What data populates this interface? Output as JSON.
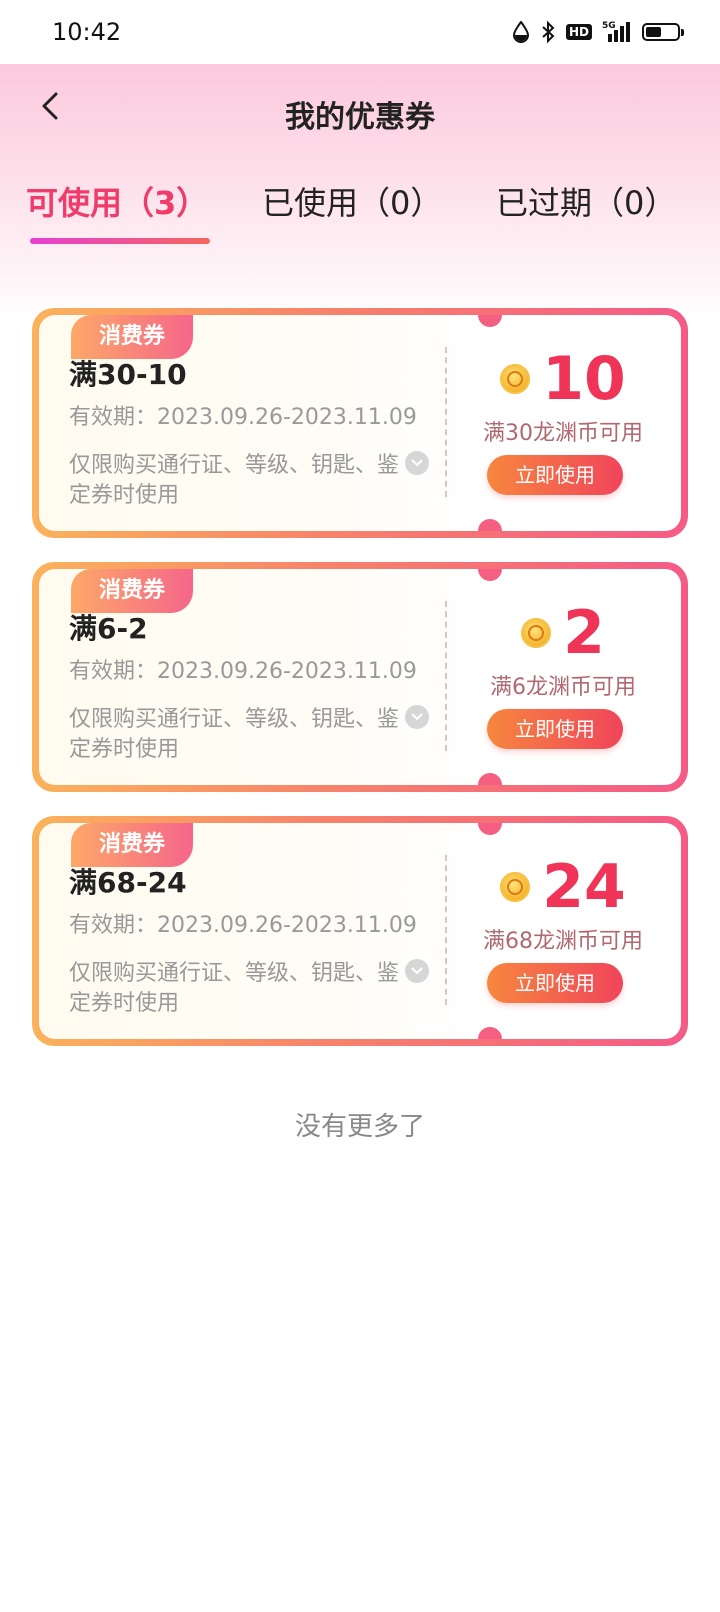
{
  "status_bar": {
    "time": "10:42",
    "hd_label": "HD",
    "network_label": "5G",
    "battery_level": 0.5
  },
  "header": {
    "title": "我的优惠券"
  },
  "tabs": [
    {
      "label": "可使用（3）",
      "active": true
    },
    {
      "label": "已使用（0）",
      "active": false
    },
    {
      "label": "已过期（0）",
      "active": false
    }
  ],
  "coupons": [
    {
      "tag": "消费券",
      "name": "满30-10",
      "validity": "有效期：2023.09.26-2023.11.09",
      "restriction": "仅限购买通行证、等级、钥匙、鉴定券时使用",
      "amount": "10",
      "condition": "满30龙渊币可用",
      "button": "立即使用"
    },
    {
      "tag": "消费券",
      "name": "满6-2",
      "validity": "有效期：2023.09.26-2023.11.09",
      "restriction": "仅限购买通行证、等级、钥匙、鉴定券时使用",
      "amount": "2",
      "condition": "满6龙渊币可用",
      "button": "立即使用"
    },
    {
      "tag": "消费券",
      "name": "满68-24",
      "validity": "有效期：2023.09.26-2023.11.09",
      "restriction": "仅限购买通行证、等级、钥匙、鉴定券时使用",
      "amount": "24",
      "condition": "满68龙渊币可用",
      "button": "立即使用"
    }
  ],
  "footer": {
    "no_more": "没有更多了"
  },
  "colors": {
    "accent": "#ef3c6a",
    "amount": "#ef3458",
    "border_start": "#fbb25c",
    "border_end": "#f45b86"
  }
}
